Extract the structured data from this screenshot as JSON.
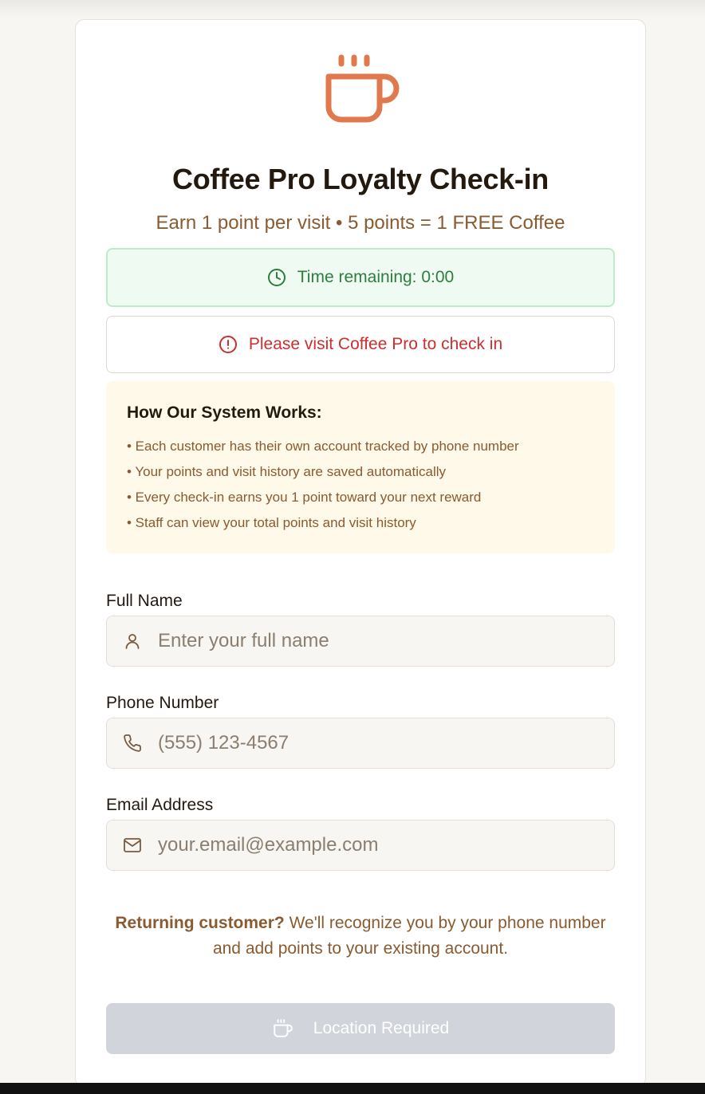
{
  "header": {
    "title": "Coffee Pro Loyalty Check-in",
    "subtitle": "Earn 1 point per visit • 5 points = 1 FREE Coffee"
  },
  "timer": {
    "text": "Time remaining: 0:00"
  },
  "alert": {
    "text": "Please visit Coffee Pro to check in"
  },
  "info": {
    "title": "How Our System Works:",
    "items": [
      "• Each customer has their own account tracked by phone number",
      "• Your points and visit history are saved automatically",
      "• Every check-in earns you 1 point toward your next reward",
      "• Staff can view your total points and visit history"
    ]
  },
  "form": {
    "name": {
      "label": "Full Name",
      "placeholder": "Enter your full name",
      "value": ""
    },
    "phone": {
      "label": "Phone Number",
      "placeholder": "(555) 123-4567",
      "value": ""
    },
    "email": {
      "label": "Email Address",
      "placeholder": "your.email@example.com",
      "value": ""
    }
  },
  "note": {
    "bold": "Returning customer?",
    "text": " We'll recognize you by your phone number and add points to your existing account."
  },
  "submit": {
    "label": "Location Required",
    "disabled": true
  },
  "colors": {
    "brand": "#e07a4e",
    "text_brown": "#8a5a30",
    "success": "#2e7d3e",
    "error": "#cc2f2f",
    "disabled_button": "#d1d4da"
  },
  "icons": {
    "logo": "coffee-cup-icon",
    "timer": "clock-icon",
    "alert": "alert-circle-icon",
    "name": "user-icon",
    "phone": "phone-icon",
    "email": "mail-icon",
    "submit": "coffee-cup-icon"
  }
}
